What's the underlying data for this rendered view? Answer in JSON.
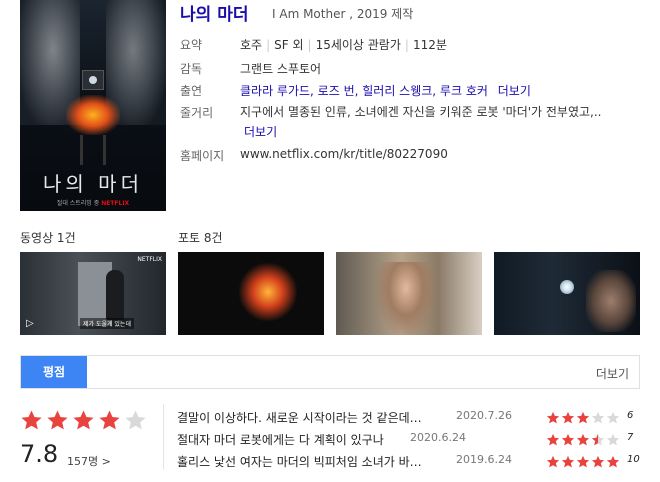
{
  "movie": {
    "poster_title": "나의 마더",
    "poster_tagline": "절대 스트리밍 중",
    "poster_brand": "NETFLIX",
    "title": "나의 마더",
    "subtitle": "I Am Mother , 2019 제작"
  },
  "info": {
    "summary_label": "요약",
    "summary": [
      "호주",
      "SF 외",
      "15세이상 관람가",
      "112분"
    ],
    "director_label": "감독",
    "director": "그랜트 스푸토어",
    "cast_label": "출연",
    "cast": "클라라 루가드, 로즈 번, 힐러리 스웽크, 루크 호커",
    "more_label": "더보기",
    "plot_label": "줄거리",
    "plot": "지구에서 멸종된 인류, 소녀에겐 자신을 키워준 로봇 '마더'가 전부였고,..",
    "homepage_label": "홈페이지",
    "homepage": "www.netflix.com/kr/title/80227090"
  },
  "media": {
    "videos_title": "동영상 1건",
    "video_caption": "제가 도울게 있는데",
    "photos_title": "포토 8건"
  },
  "ratings": {
    "tab_label": "평점",
    "more_label": "더보기",
    "score": "7.8",
    "stars_filled": 4,
    "count": "157명 >",
    "colors": {
      "star": "#e8433f",
      "empty": "#d9d9d9",
      "tab": "#3d85f5"
    },
    "reviews": [
      {
        "text": "결말이 이상하다. 새로운 시작이라는 것 같은데…",
        "date": "2020.7.26",
        "score": "6",
        "stars": 3
      },
      {
        "text": "절대자 마더 로봇에게는 다 계획이 있구나",
        "date": "2020.6.24",
        "score": "7",
        "stars": 3.5
      },
      {
        "text": "홀리스 낯선 여자는 마더의 빅피처임 소녀가 바…",
        "date": "2019.6.24",
        "score": "10",
        "stars": 5
      }
    ]
  }
}
